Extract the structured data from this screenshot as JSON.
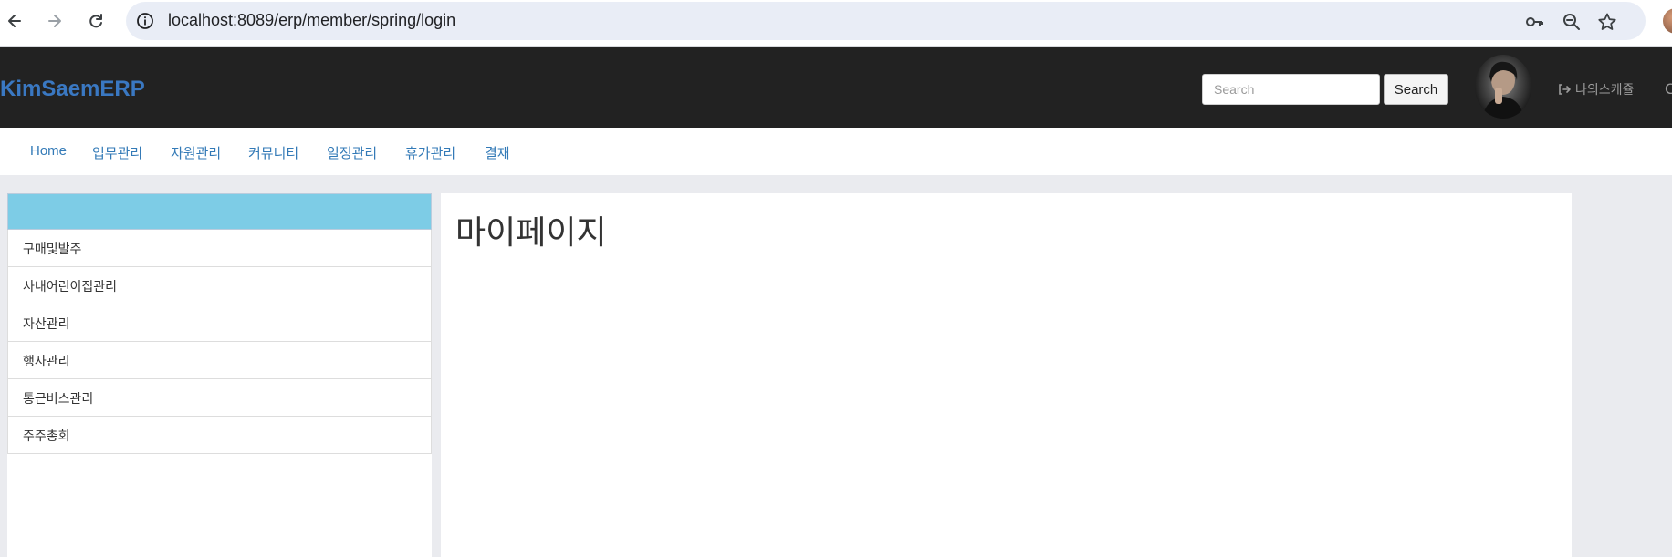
{
  "browser": {
    "url": "localhost:8089/erp/member/spring/login",
    "back_icon": "arrow-left-icon",
    "forward_icon": "arrow-right-icon",
    "reload_icon": "reload-icon",
    "site_info_icon": "info-icon",
    "password_icon": "key-icon",
    "zoom_icon": "zoom-out-icon",
    "bookmark_icon": "star-icon"
  },
  "header": {
    "brand": "KimSaemERP",
    "search_placeholder": "Search",
    "search_button": "Search",
    "schedule_link": "나의스케쥴",
    "edge_glyph": "C",
    "brand_color": "#3a78c2",
    "background_color": "#222222"
  },
  "menu": {
    "items": [
      {
        "label": "Home"
      },
      {
        "label": "업무관리"
      },
      {
        "label": "자원관리"
      },
      {
        "label": "커뮤니티"
      },
      {
        "label": "일정관리"
      },
      {
        "label": "휴가관리"
      },
      {
        "label": "결재"
      }
    ],
    "link_color": "#337ab7"
  },
  "sidebar": {
    "header_color": "#7dcce6",
    "items": [
      {
        "label": "구매및발주"
      },
      {
        "label": "사내어린이집관리"
      },
      {
        "label": "자산관리"
      },
      {
        "label": "행사관리"
      },
      {
        "label": "통근버스관리"
      },
      {
        "label": "주주총회"
      }
    ]
  },
  "main": {
    "title": "마이페이지"
  }
}
